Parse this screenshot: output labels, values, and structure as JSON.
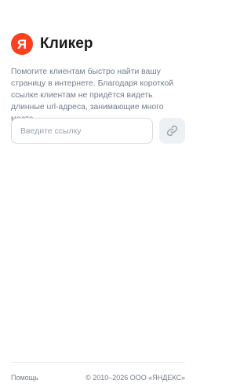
{
  "header": {
    "logo_letter": "Я",
    "title": "Кликер"
  },
  "description": "Помогите клиентам быстро найти вашу страницу в интернете. Благодаря короткой ссылке клиентам не придётся видеть длинные url-адреса, занимающие много места.",
  "form": {
    "input_value": "",
    "input_placeholder": "Введите ссылку",
    "button_icon": "link-icon"
  },
  "footer": {
    "help_label": "Помощь",
    "copyright": "© 2010–2026 ООО «ЯНДЕКС»"
  },
  "colors": {
    "brand": "#fc3f1d",
    "muted_text": "#737d8c",
    "button_bg": "#eef1f4"
  }
}
